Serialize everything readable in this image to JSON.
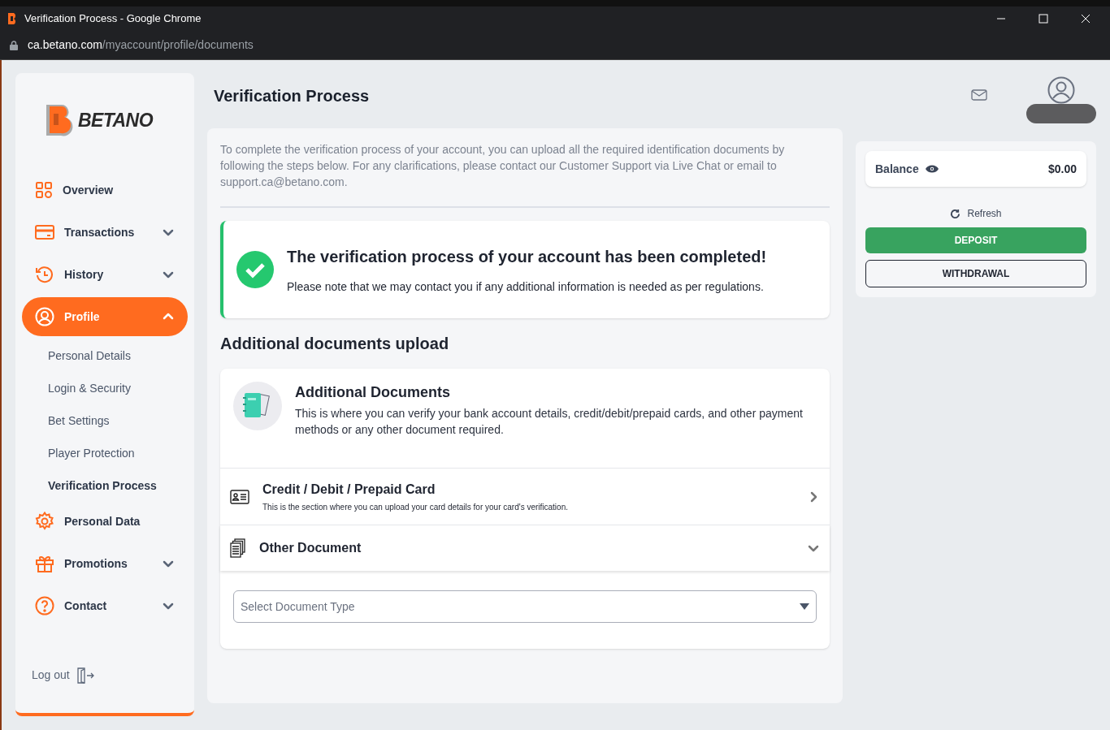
{
  "window": {
    "title": "Verification Process - Google Chrome",
    "url_host": "ca.betano.com",
    "url_path": "/myaccount/profile/documents"
  },
  "sidebar": {
    "logo": "BETANO",
    "items": [
      {
        "kind": "link",
        "label": "Overview",
        "selected": false
      },
      {
        "kind": "group",
        "label": "Transactions",
        "expanded": false,
        "selected": false
      },
      {
        "kind": "group",
        "label": "History",
        "expanded": false,
        "selected": false
      },
      {
        "kind": "group",
        "label": "Profile",
        "expanded": true,
        "selected": true,
        "children": [
          {
            "label": "Personal Details",
            "selected": false
          },
          {
            "label": "Login & Security",
            "selected": false
          },
          {
            "label": "Bet Settings",
            "selected": false
          },
          {
            "label": "Player Protection",
            "selected": false
          },
          {
            "label": "Verification Process",
            "selected": true
          }
        ]
      },
      {
        "kind": "link",
        "label": "Personal Data",
        "selected": false
      },
      {
        "kind": "group",
        "label": "Promotions",
        "expanded": false,
        "selected": false
      },
      {
        "kind": "group",
        "label": "Contact",
        "expanded": false,
        "selected": false
      }
    ],
    "logout": "Log out"
  },
  "page_title": "Verification Process",
  "intro": "To complete the verification process of your account, you can upload all the required identification documents by following the steps below. For any clarifications, please contact our Customer Support via Live Chat or email to support.ca@betano.com.",
  "status": {
    "title": "The verification process of your account has been completed!",
    "text": "Please note that we may contact you if any additional information is needed as per regulations."
  },
  "section_title": "Additional documents upload",
  "documents": {
    "title": "Additional Documents",
    "text": "This is where you can verify your bank account details, credit/debit/prepaid cards, and other payment methods or any other document required.",
    "rows": [
      {
        "kind": "card",
        "title": "Credit / Debit / Prepaid Card",
        "subtitle": "This is the section where you can upload your card details for your card's verification.",
        "expanded": false
      },
      {
        "kind": "document",
        "title": "Other Document",
        "expanded": true
      }
    ],
    "select": {
      "placeholder": "Select Document Type"
    }
  },
  "account": {
    "balance_label": "Balance",
    "balance": "$0.00",
    "refresh": "Refresh",
    "deposit": "DEPOSIT",
    "withdrawal": "WITHDRAWAL"
  }
}
